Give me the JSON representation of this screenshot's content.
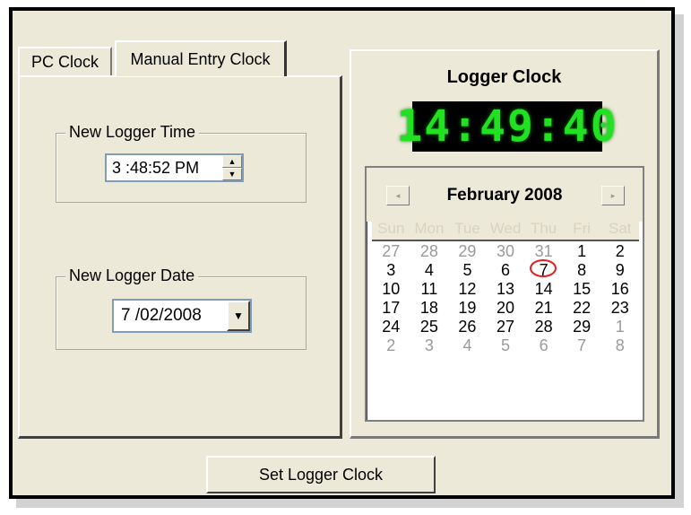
{
  "tabs": [
    {
      "label": "PC Clock"
    },
    {
      "label": "Manual Entry Clock"
    }
  ],
  "time_group": {
    "legend": "New Logger Time",
    "value": "3 :48:52 PM"
  },
  "date_group": {
    "legend": "New Logger Date",
    "value": "7 /02/2008"
  },
  "logger_clock": {
    "title": "Logger Clock",
    "display": "14:49:40"
  },
  "calendar": {
    "month_label": "February 2008",
    "weekdays": [
      "Sun",
      "Mon",
      "Tue",
      "Wed",
      "Thu",
      "Fri",
      "Sat"
    ],
    "weeks": [
      [
        "27",
        "28",
        "29",
        "30",
        "31",
        "1",
        "2"
      ],
      [
        "3",
        "4",
        "5",
        "6",
        "7",
        "8",
        "9"
      ],
      [
        "10",
        "11",
        "12",
        "13",
        "14",
        "15",
        "16"
      ],
      [
        "17",
        "18",
        "19",
        "20",
        "21",
        "22",
        "23"
      ],
      [
        "24",
        "25",
        "26",
        "27",
        "28",
        "29",
        "1"
      ],
      [
        "2",
        "3",
        "4",
        "5",
        "6",
        "7",
        "8"
      ]
    ],
    "dimmed": [
      [
        true,
        true,
        true,
        true,
        true,
        false,
        false
      ],
      [
        false,
        false,
        false,
        false,
        false,
        false,
        false
      ],
      [
        false,
        false,
        false,
        false,
        false,
        false,
        false
      ],
      [
        false,
        false,
        false,
        false,
        false,
        false,
        false
      ],
      [
        false,
        false,
        false,
        false,
        false,
        false,
        true
      ],
      [
        true,
        true,
        true,
        true,
        true,
        true,
        true
      ]
    ],
    "selected_day": "7",
    "selection_color": "#e02020"
  },
  "footer": {
    "set_button": "Set Logger Clock"
  },
  "icons": {
    "spin_up": "▲",
    "spin_down": "▼",
    "dropdown": "▼",
    "prev_month": "◂",
    "next_month": "▸"
  }
}
